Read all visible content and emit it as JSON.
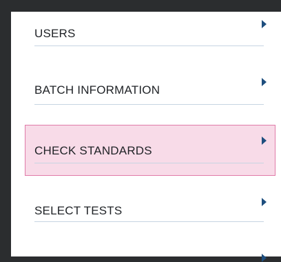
{
  "menu": {
    "items": [
      {
        "label": "USERS",
        "active": false
      },
      {
        "label": "BATCH INFORMATION",
        "active": false
      },
      {
        "label": "CHECK STANDARDS",
        "active": true
      },
      {
        "label": "SELECT TESTS",
        "active": false
      },
      {
        "label": "",
        "active": false
      }
    ]
  },
  "colors": {
    "background": "#2b2d2f",
    "panel": "#ffffff",
    "active_fill": "#f8dbe8",
    "active_border": "#e07aa8",
    "chevron": "#1e4e7e",
    "divider": "#c6d4e2",
    "text": "#1f2226"
  }
}
